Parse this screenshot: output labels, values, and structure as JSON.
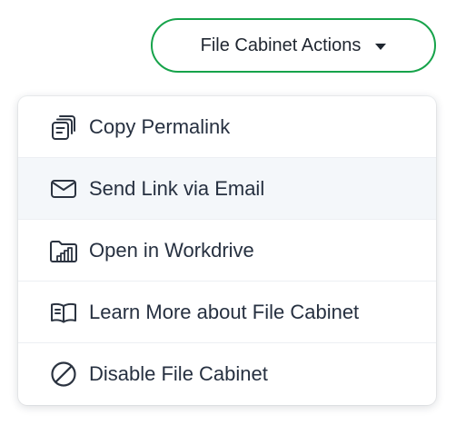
{
  "actions_button": {
    "label": "File Cabinet Actions",
    "accent_color": "#16a34a",
    "icon": "caret-down-icon"
  },
  "menu": {
    "hovered_index": 1,
    "items": [
      {
        "label": "Copy Permalink",
        "icon": "copy-icon"
      },
      {
        "label": "Send Link via Email",
        "icon": "envelope-icon"
      },
      {
        "label": "Open in Workdrive",
        "icon": "workdrive-folder-icon"
      },
      {
        "label": "Learn More about File Cabinet",
        "icon": "book-icon"
      },
      {
        "label": "Disable File Cabinet",
        "icon": "ban-icon"
      }
    ]
  }
}
